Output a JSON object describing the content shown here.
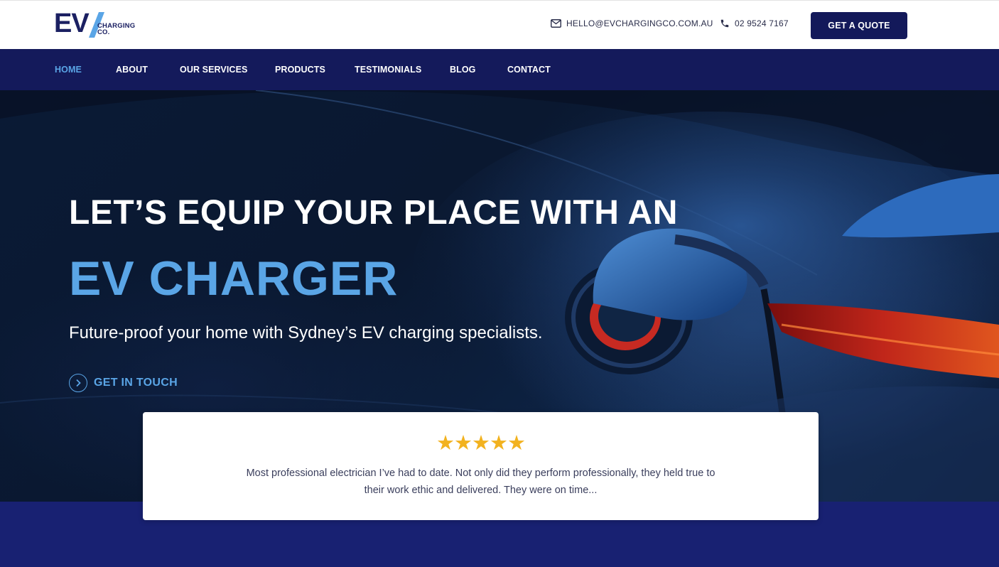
{
  "brand": {
    "logo_main": "EV",
    "logo_sub_1": "CHARGING",
    "logo_sub_2": "CO."
  },
  "header": {
    "email": "HELLO@EVCHARGINGCO.COM.AU",
    "phone": "02 9524 7167",
    "quote_button": "GET A QUOTE"
  },
  "nav": {
    "items": [
      {
        "label": "HOME",
        "active": true
      },
      {
        "label": "ABOUT"
      },
      {
        "label": "OUR SERVICES"
      },
      {
        "label": "PRODUCTS"
      },
      {
        "label": "TESTIMONIALS"
      },
      {
        "label": "BLOG"
      },
      {
        "label": "CONTACT"
      }
    ]
  },
  "hero": {
    "line1": "LET’S EQUIP YOUR PLACE WITH AN",
    "line2": "EV CHARGER",
    "subtitle": "Future-proof your home with Sydney’s EV charging specialists.",
    "cta": "GET IN TOUCH"
  },
  "review": {
    "stars": "★★★★★",
    "rating": 5,
    "text": "Most professional electrician I’ve had to date. Not only did they perform professionally, they held true to their work ethic and delivered. They were on time..."
  },
  "colors": {
    "navy": "#141a5b",
    "accent_blue": "#5aa5e6",
    "star": "#f2b21f"
  }
}
